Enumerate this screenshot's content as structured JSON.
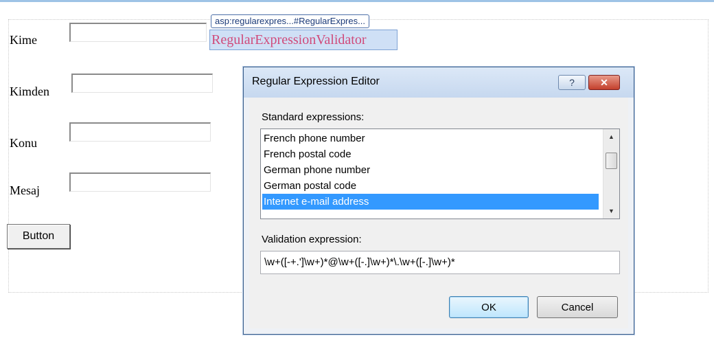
{
  "form": {
    "labels": [
      "Kime",
      "Kimden",
      "Konu",
      "Mesaj"
    ],
    "button_label": "Button"
  },
  "validator": {
    "tag": "asp:regularexpres...#RegularExpres...",
    "text": "RegularExpressionValidator"
  },
  "dialog": {
    "title": "Regular Expression Editor",
    "help_label": "?",
    "close_label": "✕",
    "standard_label": "Standard expressions:",
    "items": [
      "French phone number",
      "French postal code",
      "German phone number",
      "German postal code",
      "Internet e-mail address"
    ],
    "selected_index": 4,
    "validation_label": "Validation expression:",
    "validation_value": "\\w+([-+.']\\w+)*@\\w+([-.]\\w+)*\\.\\w+([-.]\\w+)*",
    "ok_label": "OK",
    "cancel_label": "Cancel"
  },
  "colors": {
    "validator_text": "#d04a7a",
    "selection": "#3399ff"
  }
}
